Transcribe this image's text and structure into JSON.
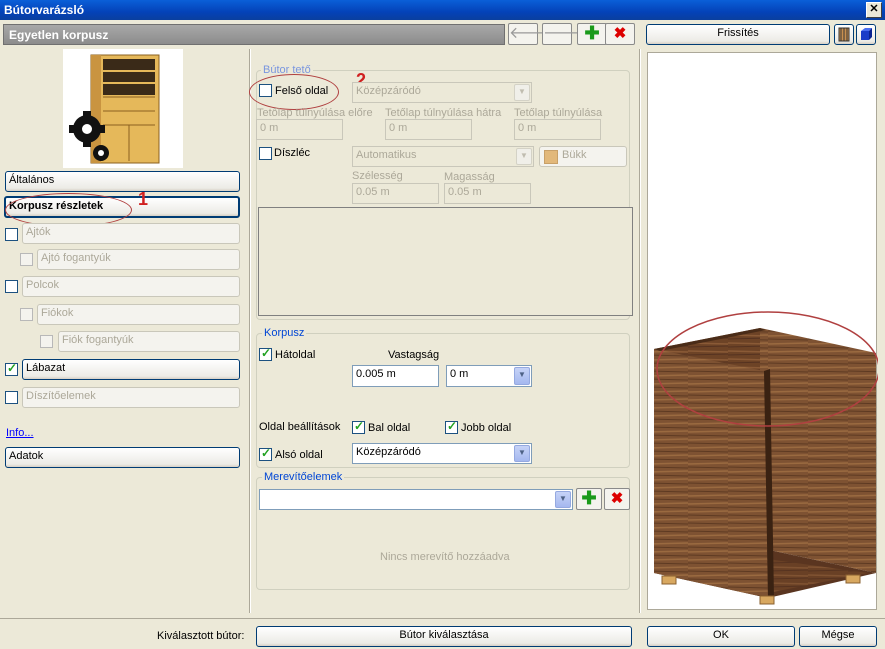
{
  "window": {
    "title": "Bútorvarázsló"
  },
  "header": {
    "title": "Egyetlen korpusz"
  },
  "left_panel": {
    "items": [
      {
        "label": "Általános"
      },
      {
        "label": "Korpusz részletek"
      },
      {
        "label": "Ajtók"
      },
      {
        "label": "Ajtó fogantyúk"
      },
      {
        "label": "Polcok"
      },
      {
        "label": "Fiókok"
      },
      {
        "label": "Fiók fogantyúk"
      },
      {
        "label": "Lábazat"
      },
      {
        "label": "Díszítőelemek"
      }
    ],
    "info_link": "Info...",
    "data_button": "Adatok",
    "annotation_1": "1"
  },
  "top_section": {
    "legend": "Bútor tető",
    "top_side_label": "Felső oldal",
    "annotation_2": "2",
    "top_combo_value": "Középzáródó",
    "overhang_front_label": "Tetőlap túlnyúlása előre",
    "overhang_back_label": "Tetőlap túlnyúlása hátra",
    "overhang_side_label": "Tetőlap túlnyúlása",
    "overhang_front_value": "0 m",
    "overhang_back_value": "0 m",
    "overhang_side_value": "0 m",
    "molding_label": "Díszléc",
    "molding_combo_value": "Automatikus",
    "material_label": "Bükk",
    "width_label": "Szélesség",
    "height_label": "Magasság",
    "width_value": "0.05 m",
    "height_value": "0.05 m"
  },
  "corpus_section": {
    "legend": "Korpusz",
    "back_label": "Hátoldal",
    "thickness_label": "Vastagság",
    "thickness_value": "0.005 m",
    "offset_value": "0 m",
    "side_settings_label": "Oldal beállítások",
    "left_side_label": "Bal oldal",
    "right_side_label": "Jobb oldal",
    "bottom_label": "Alsó oldal",
    "bottom_combo_value": "Középzáródó"
  },
  "bracing_section": {
    "legend": "Merevítőelemek",
    "combo_value": "",
    "empty_text": "Nincs merevítő hozzáadva"
  },
  "preview": {
    "refresh_button": "Frissítés"
  },
  "footer": {
    "selected_label": "Kiválasztott bútor:",
    "select_button": "Bútor kiválasztása",
    "ok_button": "OK",
    "cancel_button": "Mégse"
  },
  "colors": {
    "annotation": "#d02020",
    "title_bar": "#0a5fd8",
    "wood": "#7a4a2a"
  }
}
